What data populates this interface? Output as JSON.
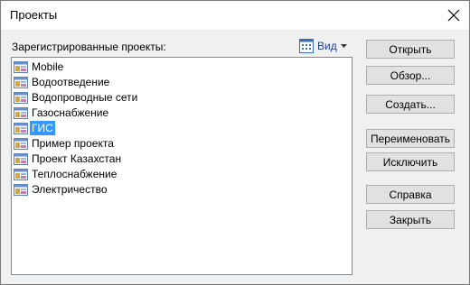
{
  "window": {
    "title": "Проекты"
  },
  "list": {
    "label": "Зарегистрированные проекты:",
    "view_label": "Вид",
    "items": [
      {
        "label": "Mobile",
        "selected": false
      },
      {
        "label": "Водоотведение",
        "selected": false
      },
      {
        "label": "Водопроводные сети",
        "selected": false
      },
      {
        "label": "Газоснабжение",
        "selected": false
      },
      {
        "label": "ГИС",
        "selected": true
      },
      {
        "label": "Пример проекта",
        "selected": false
      },
      {
        "label": "Проект Казахстан",
        "selected": false
      },
      {
        "label": "Теплоснабжение",
        "selected": false
      },
      {
        "label": "Электричество",
        "selected": false
      }
    ]
  },
  "buttons": {
    "open": "Открыть",
    "browse": "Обзор...",
    "create": "Создать...",
    "rename": "Переименовать",
    "exclude": "Исключить",
    "help": "Справка",
    "close": "Закрыть"
  },
  "colors": {
    "selection": "#3399ff",
    "link": "#1f3e8c"
  }
}
